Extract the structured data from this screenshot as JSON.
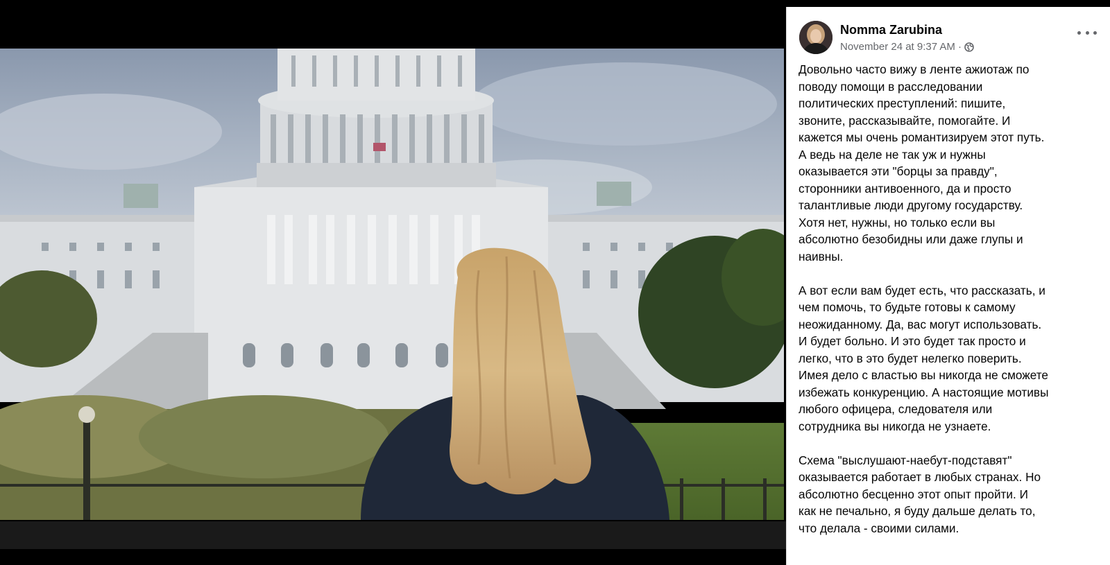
{
  "post": {
    "author": "Nomma Zarubina",
    "date": "November 24 at 9:37 AM",
    "separator": "·",
    "privacy_icon": "globe-icon",
    "more_icon": "more-options-icon",
    "paragraphs": [
      "Довольно часто вижу в ленте ажиотаж по\nповоду помощи в расследовании\nполитических преступлений: пишите,\nзвоните, рассказывайте, помогайте. И\nкажется мы очень романтизируем этот путь.\nА ведь на деле не так уж и нужны\nоказывается эти \"борцы за правду\",\nсторонники антивоенного, да и просто\nталантливые люди другому государству.\nХотя нет, нужны, но только если вы\nабсолютно безобидны или даже глупы и\nнаивны.",
      "А вот если вам будет есть, что рассказать, и\nчем помочь, то будьте готовы к самому\nнеожиданному. Да, вас могут использовать.\nИ будет больно. И это будет так просто и\nлегко, что в это будет нелегко поверить.\nИмея дело с властью вы никогда не сможете\nизбежать конкуренцию. А настоящие мотивы\nлюбого офицера, следователя или\nсотрудника вы никогда не узнаете.",
      "Схема \"выслушают-наебут-подставят\"\nоказывается работает в любых странах. Но\nабсолютно бесценно этот опыт пройти. И\nкак не печально, я буду дальше делать то,\nчто делала - своими силами."
    ]
  },
  "photo": {
    "subject": "woman with blonde hair facing the US Capitol building"
  },
  "colors": {
    "name": "#050505",
    "meta": "#65676b",
    "panel_bg": "#ffffff",
    "viewer_bg": "#000000"
  }
}
